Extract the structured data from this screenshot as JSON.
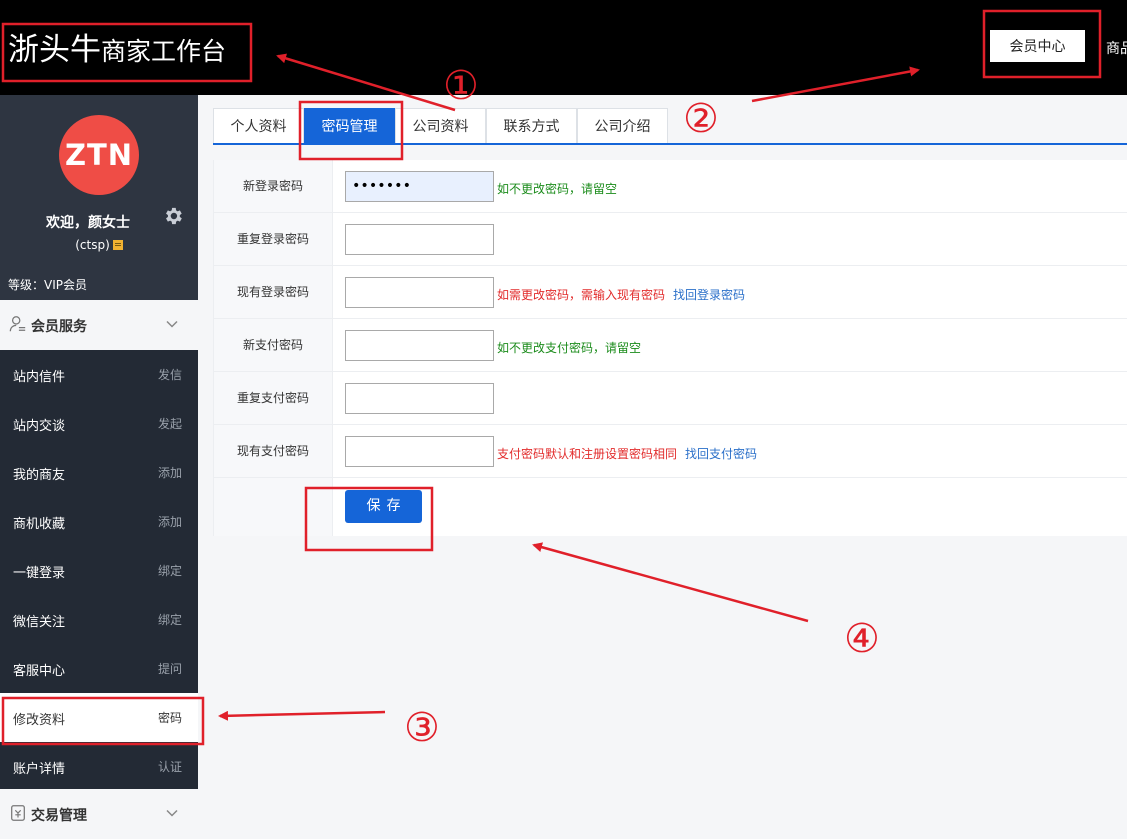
{
  "header": {
    "brand_main": "浙头牛",
    "brand_sub": "商家工作台",
    "member_center": "会员中心",
    "more": "商品"
  },
  "sidebar": {
    "avatar_text": "ZTN",
    "welcome": "欢迎，颜女士",
    "username": "(ctsp)",
    "level": "等级：VIP会员",
    "section_member": "会员服务",
    "section_trade": "交易管理",
    "items": [
      {
        "label": "站内信件",
        "action": "发信"
      },
      {
        "label": "站内交谈",
        "action": "发起"
      },
      {
        "label": "我的商友",
        "action": "添加"
      },
      {
        "label": "商机收藏",
        "action": "添加"
      },
      {
        "label": "一键登录",
        "action": "绑定"
      },
      {
        "label": "微信关注",
        "action": "绑定"
      },
      {
        "label": "客服中心",
        "action": "提问"
      },
      {
        "label": "修改资料",
        "action": "密码"
      },
      {
        "label": "账户详情",
        "action": "认证"
      }
    ]
  },
  "tabs": [
    {
      "label": "个人资料"
    },
    {
      "label": "密码管理"
    },
    {
      "label": "公司资料"
    },
    {
      "label": "联系方式"
    },
    {
      "label": "公司介绍"
    }
  ],
  "form": {
    "rows": [
      {
        "label": "新登录密码",
        "value": "•••••••",
        "hint": "如不更改密码，请留空",
        "link": ""
      },
      {
        "label": "重复登录密码",
        "value": "",
        "hint": "",
        "link": ""
      },
      {
        "label": "现有登录密码",
        "value": "",
        "hint": "如需更改密码，需输入现有密码",
        "link": "找回登录密码"
      },
      {
        "label": "新支付密码",
        "value": "",
        "hint": "如不更改支付密码，请留空",
        "link": ""
      },
      {
        "label": "重复支付密码",
        "value": "",
        "hint": "",
        "link": ""
      },
      {
        "label": "现有支付密码",
        "value": "",
        "hint": "支付密码默认和注册设置密码相同",
        "link": "找回支付密码"
      }
    ],
    "save_label": "保存"
  },
  "annotations": {
    "n1": "①",
    "n2": "②",
    "n3": "③",
    "n4": "④",
    "color": "#e0202a"
  }
}
